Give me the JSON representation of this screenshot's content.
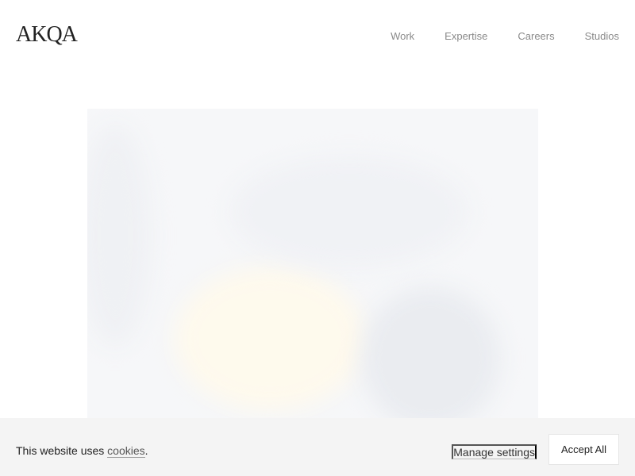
{
  "header": {
    "logo": "AKQA",
    "nav": [
      {
        "label": "Work"
      },
      {
        "label": "Expertise"
      },
      {
        "label": "Careers"
      },
      {
        "label": "Studios"
      }
    ]
  },
  "cookie_banner": {
    "text_before": "This website uses ",
    "link_label": "cookies",
    "text_after": ".",
    "manage_label": "Manage settings",
    "accept_label": "Accept All"
  }
}
